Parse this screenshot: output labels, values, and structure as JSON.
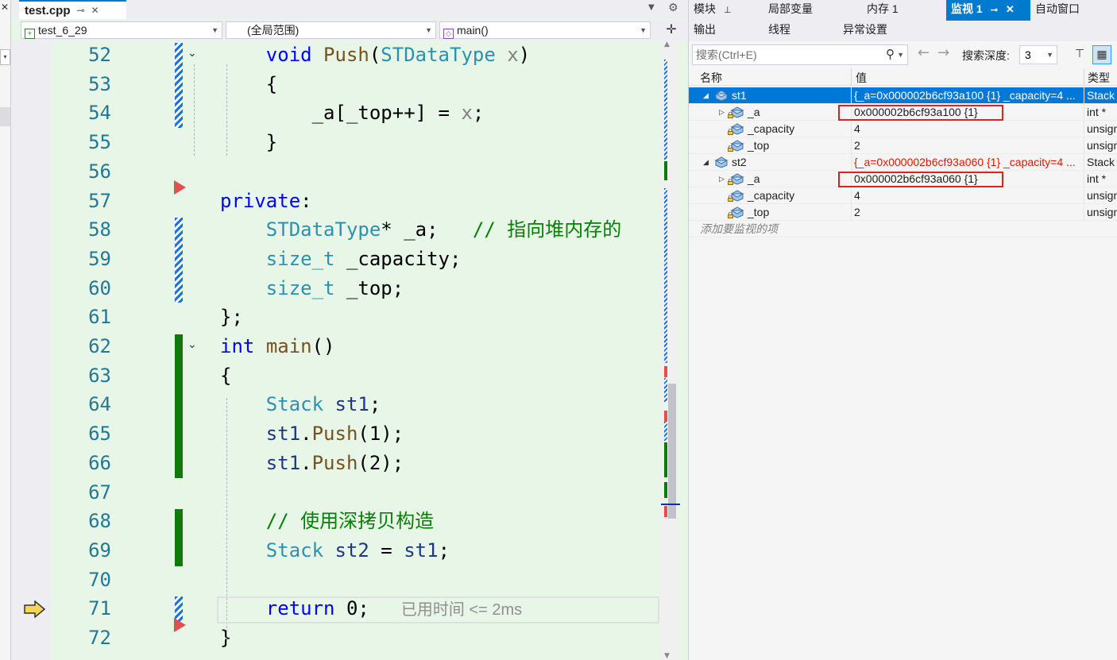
{
  "editor": {
    "file_tab": "test.cpp",
    "project_combo": "test_6_29",
    "scope_combo": "(全局范围)",
    "member_combo": "main()",
    "lines": [
      {
        "n": "52",
        "parts": [
          [
            "    ",
            ""
          ],
          [
            "void",
            "kw"
          ],
          [
            " ",
            ""
          ],
          [
            "Push",
            "fn"
          ],
          [
            "(",
            ""
          ],
          [
            "STDataType",
            "ty"
          ],
          [
            " ",
            ""
          ],
          [
            "x",
            "pa"
          ],
          [
            ")",
            ""
          ]
        ]
      },
      {
        "n": "53",
        "parts": [
          [
            "    {",
            ""
          ]
        ]
      },
      {
        "n": "54",
        "parts": [
          [
            "        _a[_top++] = ",
            ""
          ],
          [
            "x",
            "pa"
          ],
          [
            ";",
            ""
          ]
        ]
      },
      {
        "n": "55",
        "parts": [
          [
            "    }",
            ""
          ]
        ]
      },
      {
        "n": "56",
        "parts": []
      },
      {
        "n": "57",
        "parts": [
          [
            "private",
            "kw"
          ],
          [
            ":",
            ""
          ]
        ]
      },
      {
        "n": "58",
        "parts": [
          [
            "    ",
            ""
          ],
          [
            "STDataType",
            "ty"
          ],
          [
            "* _a;   ",
            ""
          ],
          [
            "// 指向堆内存的",
            "cm"
          ]
        ]
      },
      {
        "n": "59",
        "parts": [
          [
            "    ",
            ""
          ],
          [
            "size_t",
            "ty"
          ],
          [
            " _capacity;",
            ""
          ]
        ]
      },
      {
        "n": "60",
        "parts": [
          [
            "    ",
            ""
          ],
          [
            "size_t",
            "ty"
          ],
          [
            " _top;",
            ""
          ]
        ]
      },
      {
        "n": "61",
        "parts": [
          [
            "};",
            ""
          ]
        ]
      },
      {
        "n": "62",
        "parts": [
          [
            "int",
            "kw"
          ],
          [
            " ",
            ""
          ],
          [
            "main",
            "fn"
          ],
          [
            "()",
            ""
          ]
        ]
      },
      {
        "n": "63",
        "parts": [
          [
            "{",
            ""
          ]
        ]
      },
      {
        "n": "64",
        "parts": [
          [
            "    ",
            ""
          ],
          [
            "Stack",
            "ty"
          ],
          [
            " ",
            ""
          ],
          [
            "st1",
            "va"
          ],
          [
            ";",
            ""
          ]
        ]
      },
      {
        "n": "65",
        "parts": [
          [
            "    ",
            ""
          ],
          [
            "st1",
            "va"
          ],
          [
            ".",
            ""
          ],
          [
            "Push",
            "fn"
          ],
          [
            "(1);",
            ""
          ]
        ]
      },
      {
        "n": "66",
        "parts": [
          [
            "    ",
            ""
          ],
          [
            "st1",
            "va"
          ],
          [
            ".",
            ""
          ],
          [
            "Push",
            "fn"
          ],
          [
            "(2);",
            ""
          ]
        ]
      },
      {
        "n": "67",
        "parts": []
      },
      {
        "n": "68",
        "parts": [
          [
            "    ",
            ""
          ],
          [
            "// 使用深拷贝构造",
            "cm"
          ]
        ]
      },
      {
        "n": "69",
        "parts": [
          [
            "    ",
            ""
          ],
          [
            "Stack",
            "ty"
          ],
          [
            " ",
            ""
          ],
          [
            "st2",
            "va"
          ],
          [
            " = ",
            ""
          ],
          [
            "st1",
            "va"
          ],
          [
            ";",
            ""
          ]
        ]
      },
      {
        "n": "70",
        "parts": []
      },
      {
        "n": "71",
        "parts": [
          [
            "    ",
            ""
          ],
          [
            "return",
            "kw"
          ],
          [
            " 0;",
            ""
          ]
        ]
      },
      {
        "n": "72",
        "parts": [
          [
            "}",
            ""
          ]
        ]
      }
    ],
    "elapsed_hint": "已用时间 <= 2ms",
    "current_line": "71"
  },
  "panel": {
    "tabs_row1": [
      "模块",
      "局部变量",
      "内存 1",
      "监视 1",
      "自动窗口"
    ],
    "tabs_row2": [
      "输出",
      "线程",
      "异常设置"
    ],
    "search_placeholder": "搜索(Ctrl+E)",
    "depth_label": "搜索深度:",
    "depth_value": "3",
    "columns": {
      "name": "名称",
      "value": "值",
      "type": "类型"
    },
    "rows": [
      {
        "level": 0,
        "expand": "◢",
        "name": "st1",
        "value": "{_a=0x000002b6cf93a100 {1} _capacity=4 ...",
        "type": "Stack",
        "selected": true,
        "changed": true
      },
      {
        "level": 1,
        "expand": "▷",
        "name": "_a",
        "value": "0x000002b6cf93a100 {1}",
        "type": "int *",
        "boxed": true
      },
      {
        "level": 1,
        "expand": "",
        "name": "_capacity",
        "value": "4",
        "type": "unsigned"
      },
      {
        "level": 1,
        "expand": "",
        "name": "_top",
        "value": "2",
        "type": "unsigned"
      },
      {
        "level": 0,
        "expand": "◢",
        "name": "st2",
        "value": "{_a=0x000002b6cf93a060 {1} _capacity=4 ...",
        "type": "Stack",
        "changed": true
      },
      {
        "level": 1,
        "expand": "▷",
        "name": "_a",
        "value": "0x000002b6cf93a060 {1}",
        "type": "int *",
        "boxed": true
      },
      {
        "level": 1,
        "expand": "",
        "name": "_capacity",
        "value": "4",
        "type": "unsigned"
      },
      {
        "level": 1,
        "expand": "",
        "name": "_top",
        "value": "2",
        "type": "unsigned"
      }
    ],
    "add_watch": "添加要监视的项"
  },
  "colors": {
    "accent": "#007acc",
    "selection": "#0078d7",
    "changed_value": "#e51400",
    "editor_bg": "#e8f6e8"
  }
}
